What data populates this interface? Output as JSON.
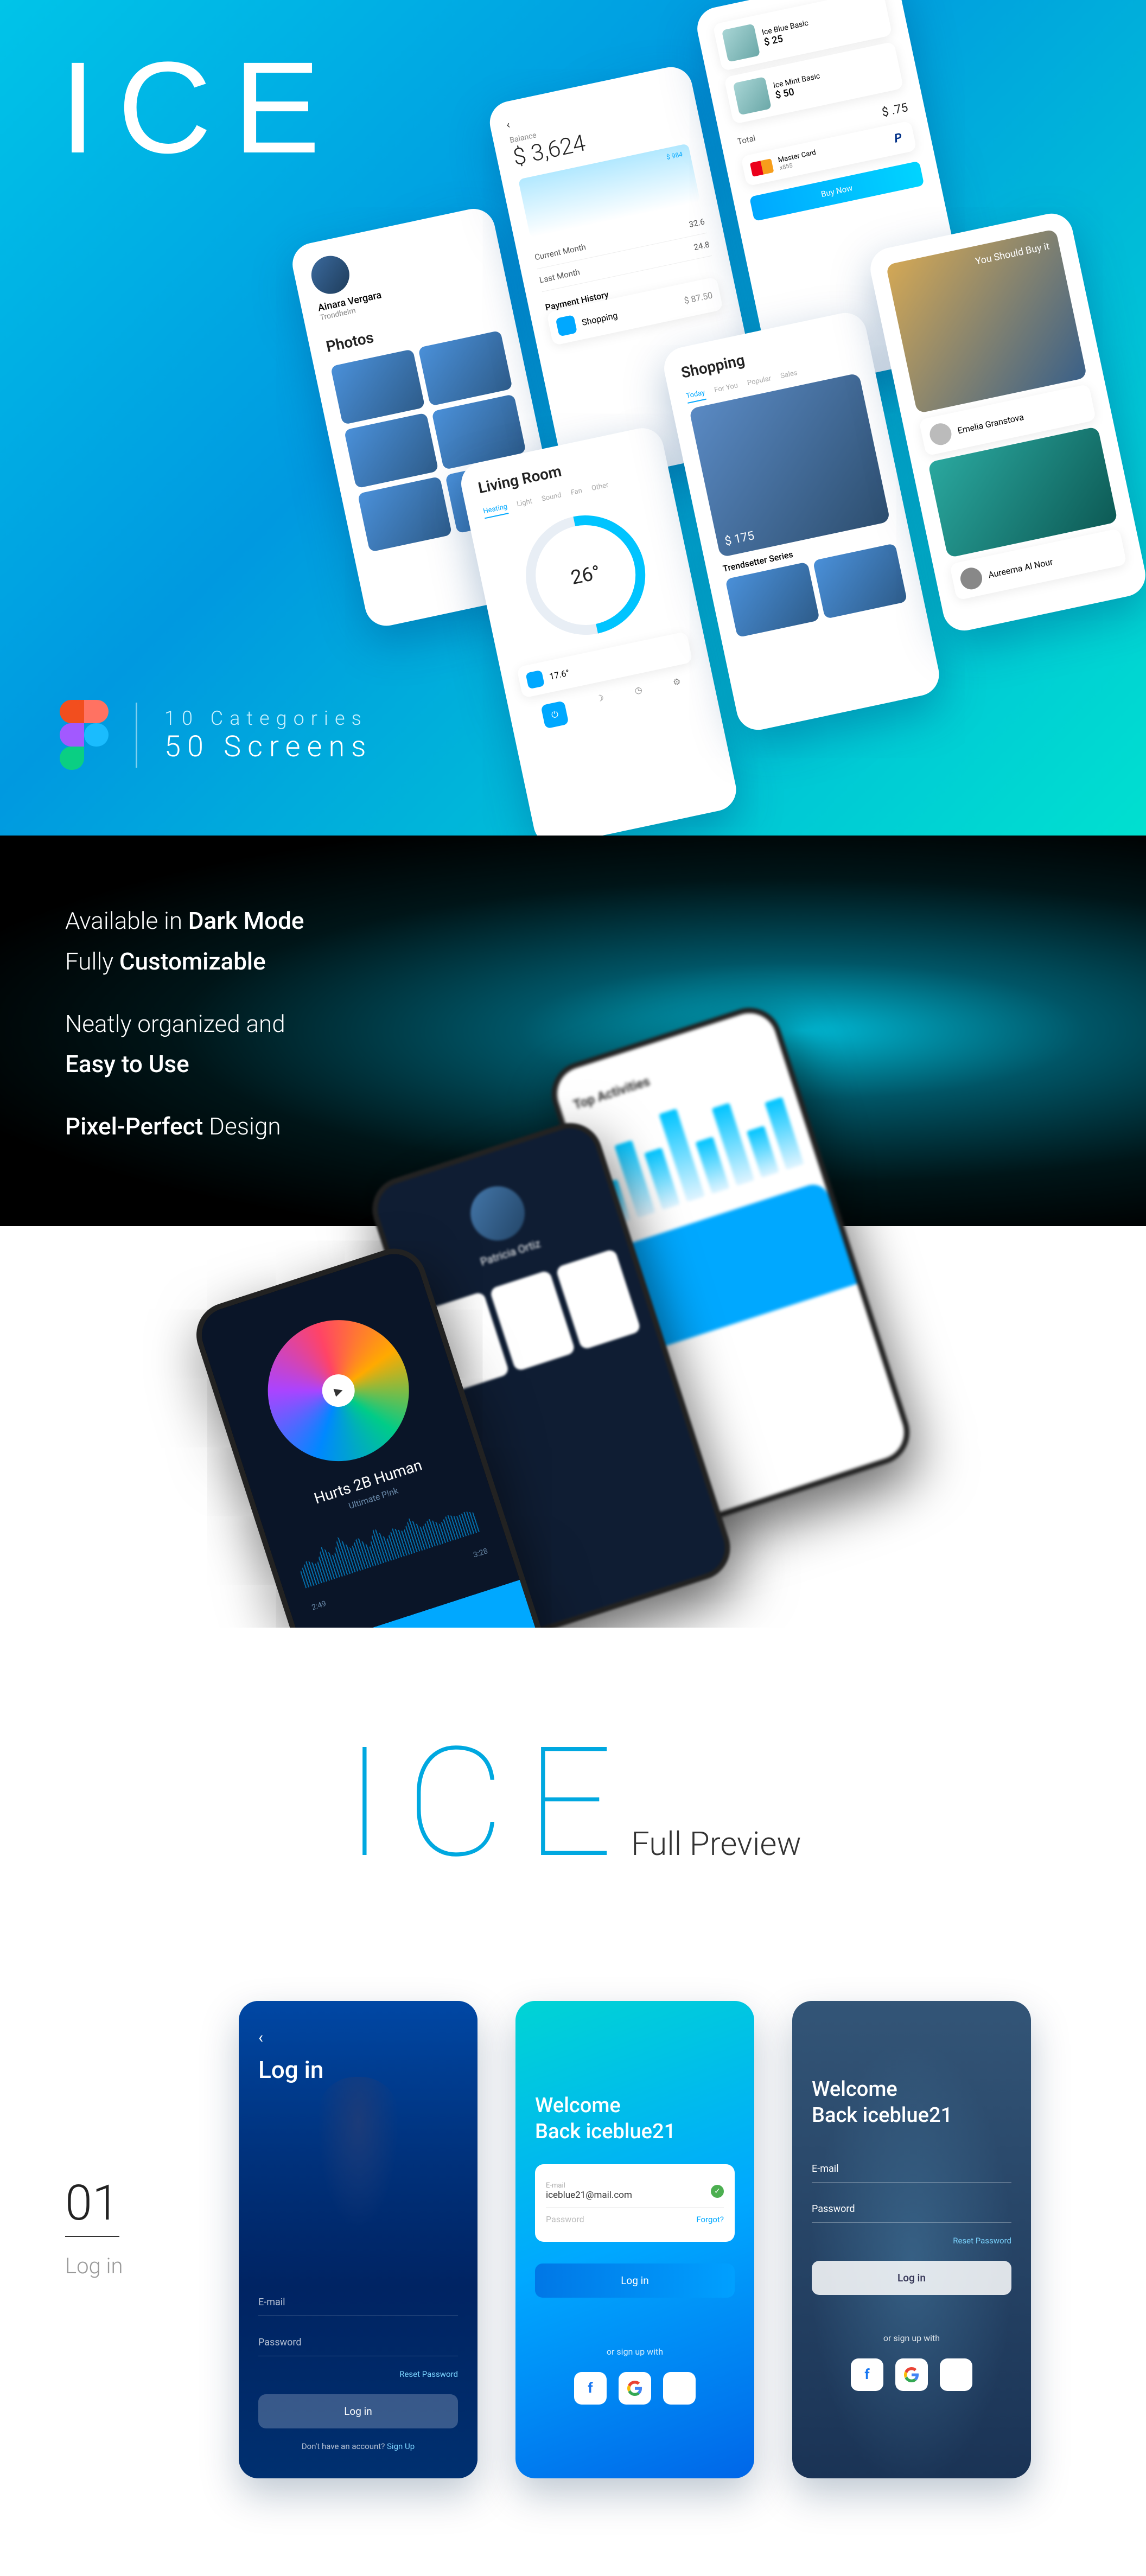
{
  "hero": {
    "logo": "ICE",
    "categories_line": "10 Categories",
    "screens_line": "50 Screens",
    "phones": {
      "profile": {
        "name": "Ainara Vergara",
        "location": "Trondheim",
        "section": "Photos"
      },
      "balance": {
        "label": "Balance",
        "amount": "$ 3,624",
        "chart_label": "$ 984",
        "current_month_lbl": "Current Month",
        "current_month_val": "32.6",
        "last_month_lbl": "Last Month",
        "last_month_val": "24.8",
        "history_lbl": "Payment History",
        "history_item": "Shopping",
        "history_price": "$ 87.50"
      },
      "cart": {
        "item1_name": "Ice Blue Basic",
        "item1_price": "$ 25",
        "item2_name": "Ice Mint Basic",
        "item2_price": "$ 50",
        "total_lbl": "Total",
        "total_val": "$ .75",
        "card_name": "Master Card",
        "card_last": "x855",
        "buy_btn": "Buy Now"
      },
      "thermo": {
        "room": "Living Room",
        "tabs": [
          "Heating",
          "Light",
          "Sound",
          "Fan",
          "Other"
        ],
        "temp": "26°",
        "preset": "17.6°"
      },
      "shop": {
        "title": "Shopping",
        "tabs": [
          "Today",
          "For You",
          "Popular",
          "Sales"
        ],
        "price": "$ 175",
        "series": "Trendsetter Series"
      },
      "recommend": {
        "headline": "You Should Buy it",
        "name1": "Emelia Granstova",
        "name2": "Aureema Al Nour"
      }
    }
  },
  "dark": {
    "feat1a": "Available in ",
    "feat1b": "Dark Mode",
    "feat2a": "Fully ",
    "feat2b": "Customizable",
    "feat3a": "Neatly organized and",
    "feat3b": "Easy to Use",
    "feat4a": "Pixel-Perfect ",
    "feat4b": "Design",
    "player": {
      "song": "Hurts 2B Human",
      "artist": "Ultimate P!nk",
      "time_cur": "2:49",
      "time_end": "3:28"
    },
    "profile": {
      "name": "Patricia Ortiz"
    },
    "activities": {
      "title": "Top Activities"
    }
  },
  "preview": {
    "logo": "ICE",
    "sub": "Full Preview"
  },
  "section01": {
    "num": "01",
    "name": "Log in",
    "s1": {
      "title": "Log in",
      "email": "E-mail",
      "password": "Password",
      "reset": "Reset Password",
      "btn": "Log in",
      "noacct": "Don't have an account? ",
      "signup": "Sign Up"
    },
    "s2": {
      "welcome1": "Welcome",
      "welcome2": "Back iceblue21",
      "email_lbl": "E-mail",
      "email_val": "iceblue21@mail.com",
      "pw_placeholder": "Password",
      "forgot": "Forgot?",
      "btn": "Log in",
      "or": "or sign up with"
    },
    "s3": {
      "welcome1": "Welcome",
      "welcome2": "Back iceblue21",
      "email": "E-mail",
      "password": "Password",
      "reset": "Reset Password",
      "btn": "Log in",
      "or": "or sign up with"
    }
  }
}
